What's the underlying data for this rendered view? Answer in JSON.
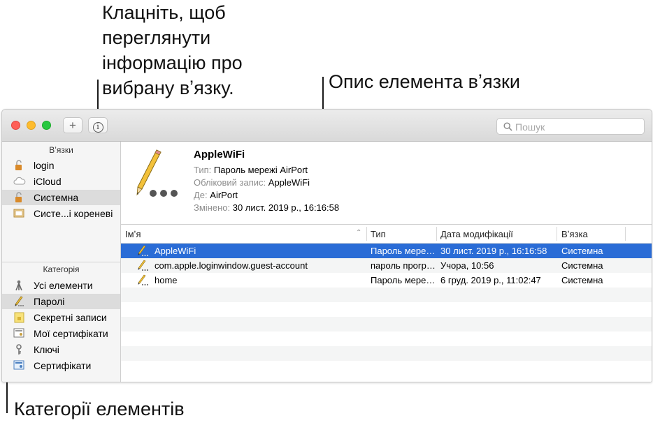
{
  "callouts": {
    "info_line1": "Клацніть, щоб",
    "info_line2": "переглянути",
    "info_line3": "інформацію про",
    "info_line4": "вибрану вʼязку.",
    "description": "Опис елемента вʼязки",
    "categories": "Категорії елементів"
  },
  "toolbar": {
    "add_label": "+",
    "info_label": "i",
    "search_placeholder": "Пошук"
  },
  "sidebar": {
    "keychains_header": "Вʼязки",
    "keychains": [
      {
        "label": "login",
        "icon": "lock-open-icon"
      },
      {
        "label": "iCloud",
        "icon": "cloud-icon"
      },
      {
        "label": "Системна",
        "icon": "lock-icon"
      },
      {
        "label": "Систе...і кореневі",
        "icon": "certificate-folder-icon"
      }
    ],
    "category_header": "Категорія",
    "categories": [
      {
        "label": "Усі елементи",
        "icon": "all-items-icon"
      },
      {
        "label": "Паролі",
        "icon": "pencil-icon"
      },
      {
        "label": "Секретні записи",
        "icon": "secure-note-icon"
      },
      {
        "label": "Мої сертифікати",
        "icon": "my-certificate-icon"
      },
      {
        "label": "Ключі",
        "icon": "key-icon"
      },
      {
        "label": "Сертифікати",
        "icon": "certificate-icon"
      }
    ]
  },
  "detail": {
    "name": "AppleWiFi",
    "kind_key": "Тип:",
    "kind_value": "Пароль мережі AirPort",
    "account_key": "Обліковий запис:",
    "account_value": "AppleWiFi",
    "where_key": "Де:",
    "where_value": "AirPort",
    "modified_key": "Змінено:",
    "modified_value": "30 лист. 2019 р., 16:16:58"
  },
  "table": {
    "columns": [
      "Імʼя",
      "Тип",
      "Дата модифікації",
      "Вʼязка"
    ],
    "rows": [
      {
        "name": "AppleWiFi",
        "kind": "Пароль мере…",
        "date": "30 лист. 2019 р., 16:16:58",
        "keychain": "Системна"
      },
      {
        "name": "com.apple.loginwindow.guest-account",
        "kind": "пароль прогр…",
        "date": "Учора, 10:56",
        "keychain": "Системна"
      },
      {
        "name": "home",
        "kind": "Пароль мере…",
        "date": "6 груд. 2019 р., 11:02:47",
        "keychain": "Системна"
      }
    ]
  },
  "colors": {
    "selection": "#2a6cd6",
    "close": "#fe5f57",
    "minimize": "#febc2e",
    "zoom": "#28c840"
  }
}
